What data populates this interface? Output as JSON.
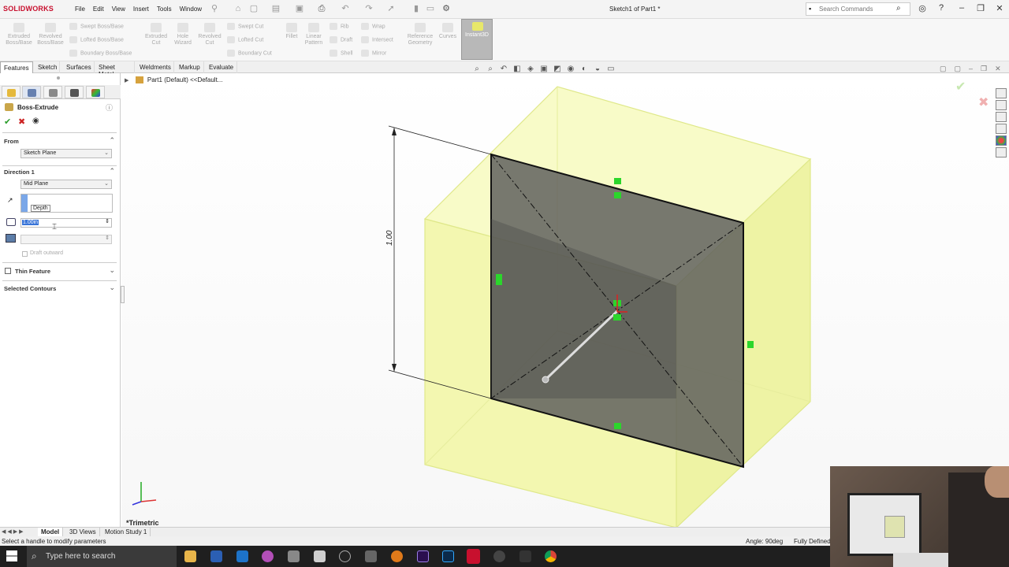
{
  "app": {
    "logo_text": "SOLIDWORKS",
    "document_title": "Sketch1 of Part1 *",
    "menu": [
      "File",
      "Edit",
      "View",
      "Insert",
      "Tools",
      "Window"
    ],
    "search_placeholder": "Search Commands"
  },
  "command_manager": {
    "extruded": "Extruded\nBoss/Base",
    "revolved": "Revolved\nBoss/Base",
    "swept_boss": "Swept Boss/Base",
    "lofted_boss": "Lofted Boss/Base",
    "boundary_boss": "Boundary Boss/Base",
    "extruded_cut": "Extruded\nCut",
    "hole_wizard": "Hole\nWizard",
    "revolved_cut": "Revolved\nCut",
    "swept_cut": "Swept Cut",
    "lofted_cut": "Lofted Cut",
    "boundary_cut": "Boundary Cut",
    "fillet": "Fillet",
    "linear_pattern": "Linear\nPattern",
    "rib": "Rib",
    "draft": "Draft",
    "shell": "Shell",
    "wrap": "Wrap",
    "intersect": "Intersect",
    "mirror": "Mirror",
    "reference_geometry": "Reference\nGeometry",
    "curves": "Curves",
    "instant3d": "Instant3D"
  },
  "tabs": [
    "Features",
    "Sketch",
    "Surfaces",
    "Sheet Metal",
    "Weldments",
    "Markup",
    "Evaluate"
  ],
  "property_manager": {
    "title": "Boss-Extrude",
    "from_label": "From",
    "from_value": "Sketch Plane",
    "direction_label": "Direction 1",
    "direction_value": "Mid Plane",
    "depth_tooltip": "Depth",
    "depth_value": "1.00in",
    "draft_outward": "Draft outward",
    "thin_feature": "Thin Feature",
    "selected_contours": "Selected Contours"
  },
  "tree": {
    "part_label": "Part1 (Default) <<Default..."
  },
  "viewport": {
    "dimension_label": "1.00",
    "view_name": "*Trimetric",
    "colors": {
      "preview_fill": "#f3f7b0",
      "preview_edge": "#d9e36b",
      "sketch_face": "#6e6e6e"
    }
  },
  "bottom_tabs": [
    "Model",
    "3D Views",
    "Motion Study 1"
  ],
  "status": {
    "hint": "Select a handle to modify parameters",
    "angle": "Angle: 90deg",
    "defined": "Fully Defined"
  },
  "taskbar": {
    "search_placeholder": "Type here to search"
  }
}
